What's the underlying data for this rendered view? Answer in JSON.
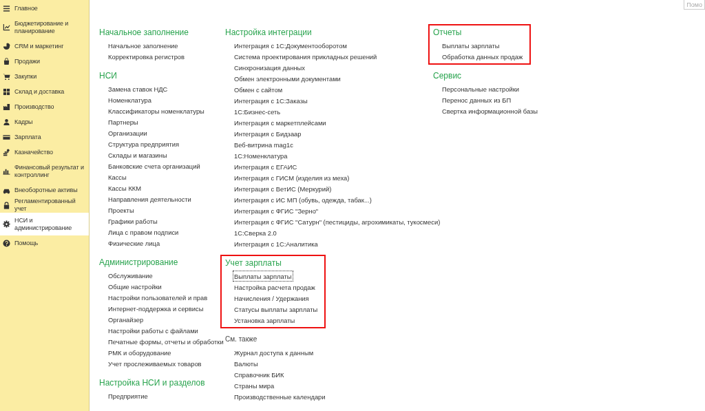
{
  "sidebar": {
    "items": [
      {
        "label": "Главное",
        "selected": false
      },
      {
        "label": "Бюджетирование и планирование",
        "selected": false
      },
      {
        "label": "CRM и маркетинг",
        "selected": false
      },
      {
        "label": "Продажи",
        "selected": false
      },
      {
        "label": "Закупки",
        "selected": false
      },
      {
        "label": "Склад и доставка",
        "selected": false
      },
      {
        "label": "Производство",
        "selected": false
      },
      {
        "label": "Кадры",
        "selected": false
      },
      {
        "label": "Зарплата",
        "selected": false
      },
      {
        "label": "Казначейство",
        "selected": false
      },
      {
        "label": "Финансовый результат и контроллинг",
        "selected": false
      },
      {
        "label": "Внеоборотные активы",
        "selected": false
      },
      {
        "label": "Регламентированный учет",
        "selected": false
      },
      {
        "label": "НСИ и администрирование",
        "selected": true
      },
      {
        "label": "Помощь",
        "selected": false
      }
    ]
  },
  "search": {
    "placeholder": "Помо"
  },
  "columns": [
    [
      {
        "title": "Начальное заполнение",
        "kind": "section",
        "highlighted": false,
        "items": [
          {
            "label": "Начальное заполнение",
            "focused": false
          },
          {
            "label": "Корректировка регистров",
            "focused": false
          }
        ]
      },
      {
        "title": "НСИ",
        "kind": "section",
        "highlighted": false,
        "items": [
          {
            "label": "Замена ставок НДС",
            "focused": false
          },
          {
            "label": "Номенклатура",
            "focused": false
          },
          {
            "label": "Классификаторы номенклатуры",
            "focused": false
          },
          {
            "label": "Партнеры",
            "focused": false
          },
          {
            "label": "Организации",
            "focused": false
          },
          {
            "label": "Структура предприятия",
            "focused": false
          },
          {
            "label": "Склады и магазины",
            "focused": false
          },
          {
            "label": "Банковские счета организаций",
            "focused": false
          },
          {
            "label": "Кассы",
            "focused": false
          },
          {
            "label": "Кассы ККМ",
            "focused": false
          },
          {
            "label": "Направления деятельности",
            "focused": false
          },
          {
            "label": "Проекты",
            "focused": false
          },
          {
            "label": "Графики работы",
            "focused": false
          },
          {
            "label": "Лица с правом подписи",
            "focused": false
          },
          {
            "label": "Физические лица",
            "focused": false
          }
        ]
      },
      {
        "title": "Администрирование",
        "kind": "section",
        "highlighted": false,
        "items": [
          {
            "label": "Обслуживание",
            "focused": false
          },
          {
            "label": "Общие настройки",
            "focused": false
          },
          {
            "label": "Настройки пользователей и прав",
            "focused": false
          },
          {
            "label": "Интернет-поддержка и сервисы",
            "focused": false
          },
          {
            "label": "Органайзер",
            "focused": false
          },
          {
            "label": "Настройки работы с файлами",
            "focused": false
          },
          {
            "label": "Печатные формы, отчеты и обработки",
            "focused": false
          },
          {
            "label": "РМК и оборудование",
            "focused": false
          },
          {
            "label": "Учет прослеживаемых товаров",
            "focused": false
          }
        ]
      },
      {
        "title": "Настройка НСИ и разделов",
        "kind": "section",
        "highlighted": false,
        "items": [
          {
            "label": "Предприятие",
            "focused": false
          }
        ]
      }
    ],
    [
      {
        "title": "Настройка интеграции",
        "kind": "section",
        "highlighted": false,
        "items": [
          {
            "label": "Интеграция с 1С:Документооборотом",
            "focused": false
          },
          {
            "label": "Система проектирования прикладных решений",
            "focused": false
          },
          {
            "label": "Синхронизация данных",
            "focused": false
          },
          {
            "label": "Обмен электронными документами",
            "focused": false
          },
          {
            "label": "Обмен с сайтом",
            "focused": false
          },
          {
            "label": "Интеграция с 1С:Заказы",
            "focused": false
          },
          {
            "label": "1С:Бизнес-сеть",
            "focused": false
          },
          {
            "label": "Интеграция с маркетплейсами",
            "focused": false
          },
          {
            "label": "Интеграция с Бидзаар",
            "focused": false
          },
          {
            "label": "Веб-витрина mag1c",
            "focused": false
          },
          {
            "label": "1С:Номенклатура",
            "focused": false
          },
          {
            "label": "Интеграция с ЕГАИС",
            "focused": false
          },
          {
            "label": "Интеграция с ГИСМ (изделия из меха)",
            "focused": false
          },
          {
            "label": "Интеграция с ВетИС (Меркурий)",
            "focused": false
          },
          {
            "label": "Интеграция с ИС МП (обувь, одежда, табак...)",
            "focused": false
          },
          {
            "label": "Интеграция с ФГИС \"Зерно\"",
            "focused": false
          },
          {
            "label": "Интеграция с ФГИС \"Сатурн\" (пестициды, агрохимикаты, тукосмеси)",
            "focused": false
          },
          {
            "label": "1С:Сверка 2.0",
            "focused": false
          },
          {
            "label": "Интеграция с 1С:Аналитика",
            "focused": false
          }
        ]
      },
      {
        "title": "Учет зарплаты",
        "kind": "section",
        "highlighted": true,
        "items": [
          {
            "label": "Выплаты зарплаты",
            "focused": true
          },
          {
            "label": "Настройка расчета продаж",
            "focused": false
          },
          {
            "label": "Начисления / Удержания",
            "focused": false
          },
          {
            "label": "Статусы выплаты зарплаты",
            "focused": false
          },
          {
            "label": "Установка зарплаты",
            "focused": false
          }
        ]
      },
      {
        "title": "См. также",
        "kind": "see_also",
        "highlighted": false,
        "items": [
          {
            "label": "Журнал доступа к данным",
            "focused": false
          },
          {
            "label": "Валюты",
            "focused": false
          },
          {
            "label": "Справочник БИК",
            "focused": false
          },
          {
            "label": "Страны мира",
            "focused": false
          },
          {
            "label": "Производственные календари",
            "focused": false
          }
        ]
      }
    ],
    [
      {
        "title": "Отчеты",
        "kind": "section",
        "highlighted": true,
        "items": [
          {
            "label": "Выплаты зарплаты",
            "focused": false
          },
          {
            "label": "Обработка данных продаж",
            "focused": false
          }
        ]
      },
      {
        "title": "Сервис",
        "kind": "section",
        "highlighted": false,
        "items": [
          {
            "label": "Персональные настройки",
            "focused": false
          },
          {
            "label": "Перенос данных из БП",
            "focused": false
          },
          {
            "label": "Свертка информационной базы",
            "focused": false
          }
        ]
      }
    ]
  ]
}
